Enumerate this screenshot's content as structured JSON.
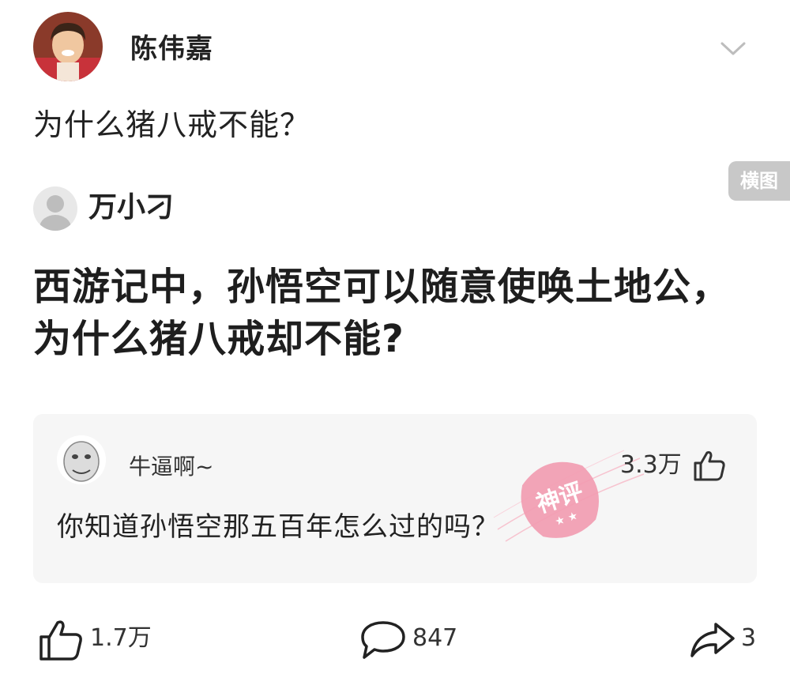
{
  "header": {
    "username": "陈伟嘉"
  },
  "post": {
    "title": "为什么猪八戒不能？"
  },
  "badge": {
    "label": "横图"
  },
  "embedded": {
    "author": "万小刁",
    "headline": "西游记中，孙悟空可以随意使唤土地公，为什么猪八戒却不能?"
  },
  "comment": {
    "author": "牛逼啊~",
    "likes": "3.3万",
    "text": "你知道孙悟空那五百年怎么过的吗？",
    "stamp_text": "神评"
  },
  "actions": {
    "likes": "1.7万",
    "comments": "847",
    "shares": "3"
  },
  "colors": {
    "card_bg": "#f6f6f6",
    "stamp": "#f08fa8"
  }
}
